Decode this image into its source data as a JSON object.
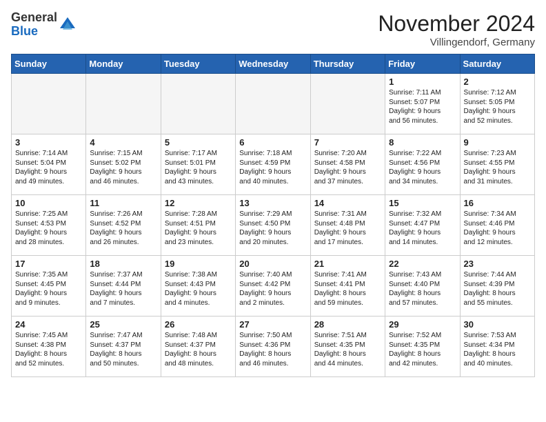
{
  "logo": {
    "general": "General",
    "blue": "Blue"
  },
  "title": "November 2024",
  "location": "Villingendorf, Germany",
  "days_of_week": [
    "Sunday",
    "Monday",
    "Tuesday",
    "Wednesday",
    "Thursday",
    "Friday",
    "Saturday"
  ],
  "weeks": [
    [
      {
        "day": "",
        "info": ""
      },
      {
        "day": "",
        "info": ""
      },
      {
        "day": "",
        "info": ""
      },
      {
        "day": "",
        "info": ""
      },
      {
        "day": "",
        "info": ""
      },
      {
        "day": "1",
        "info": "Sunrise: 7:11 AM\nSunset: 5:07 PM\nDaylight: 9 hours\nand 56 minutes."
      },
      {
        "day": "2",
        "info": "Sunrise: 7:12 AM\nSunset: 5:05 PM\nDaylight: 9 hours\nand 52 minutes."
      }
    ],
    [
      {
        "day": "3",
        "info": "Sunrise: 7:14 AM\nSunset: 5:04 PM\nDaylight: 9 hours\nand 49 minutes."
      },
      {
        "day": "4",
        "info": "Sunrise: 7:15 AM\nSunset: 5:02 PM\nDaylight: 9 hours\nand 46 minutes."
      },
      {
        "day": "5",
        "info": "Sunrise: 7:17 AM\nSunset: 5:01 PM\nDaylight: 9 hours\nand 43 minutes."
      },
      {
        "day": "6",
        "info": "Sunrise: 7:18 AM\nSunset: 4:59 PM\nDaylight: 9 hours\nand 40 minutes."
      },
      {
        "day": "7",
        "info": "Sunrise: 7:20 AM\nSunset: 4:58 PM\nDaylight: 9 hours\nand 37 minutes."
      },
      {
        "day": "8",
        "info": "Sunrise: 7:22 AM\nSunset: 4:56 PM\nDaylight: 9 hours\nand 34 minutes."
      },
      {
        "day": "9",
        "info": "Sunrise: 7:23 AM\nSunset: 4:55 PM\nDaylight: 9 hours\nand 31 minutes."
      }
    ],
    [
      {
        "day": "10",
        "info": "Sunrise: 7:25 AM\nSunset: 4:53 PM\nDaylight: 9 hours\nand 28 minutes."
      },
      {
        "day": "11",
        "info": "Sunrise: 7:26 AM\nSunset: 4:52 PM\nDaylight: 9 hours\nand 26 minutes."
      },
      {
        "day": "12",
        "info": "Sunrise: 7:28 AM\nSunset: 4:51 PM\nDaylight: 9 hours\nand 23 minutes."
      },
      {
        "day": "13",
        "info": "Sunrise: 7:29 AM\nSunset: 4:50 PM\nDaylight: 9 hours\nand 20 minutes."
      },
      {
        "day": "14",
        "info": "Sunrise: 7:31 AM\nSunset: 4:48 PM\nDaylight: 9 hours\nand 17 minutes."
      },
      {
        "day": "15",
        "info": "Sunrise: 7:32 AM\nSunset: 4:47 PM\nDaylight: 9 hours\nand 14 minutes."
      },
      {
        "day": "16",
        "info": "Sunrise: 7:34 AM\nSunset: 4:46 PM\nDaylight: 9 hours\nand 12 minutes."
      }
    ],
    [
      {
        "day": "17",
        "info": "Sunrise: 7:35 AM\nSunset: 4:45 PM\nDaylight: 9 hours\nand 9 minutes."
      },
      {
        "day": "18",
        "info": "Sunrise: 7:37 AM\nSunset: 4:44 PM\nDaylight: 9 hours\nand 7 minutes."
      },
      {
        "day": "19",
        "info": "Sunrise: 7:38 AM\nSunset: 4:43 PM\nDaylight: 9 hours\nand 4 minutes."
      },
      {
        "day": "20",
        "info": "Sunrise: 7:40 AM\nSunset: 4:42 PM\nDaylight: 9 hours\nand 2 minutes."
      },
      {
        "day": "21",
        "info": "Sunrise: 7:41 AM\nSunset: 4:41 PM\nDaylight: 8 hours\nand 59 minutes."
      },
      {
        "day": "22",
        "info": "Sunrise: 7:43 AM\nSunset: 4:40 PM\nDaylight: 8 hours\nand 57 minutes."
      },
      {
        "day": "23",
        "info": "Sunrise: 7:44 AM\nSunset: 4:39 PM\nDaylight: 8 hours\nand 55 minutes."
      }
    ],
    [
      {
        "day": "24",
        "info": "Sunrise: 7:45 AM\nSunset: 4:38 PM\nDaylight: 8 hours\nand 52 minutes."
      },
      {
        "day": "25",
        "info": "Sunrise: 7:47 AM\nSunset: 4:37 PM\nDaylight: 8 hours\nand 50 minutes."
      },
      {
        "day": "26",
        "info": "Sunrise: 7:48 AM\nSunset: 4:37 PM\nDaylight: 8 hours\nand 48 minutes."
      },
      {
        "day": "27",
        "info": "Sunrise: 7:50 AM\nSunset: 4:36 PM\nDaylight: 8 hours\nand 46 minutes."
      },
      {
        "day": "28",
        "info": "Sunrise: 7:51 AM\nSunset: 4:35 PM\nDaylight: 8 hours\nand 44 minutes."
      },
      {
        "day": "29",
        "info": "Sunrise: 7:52 AM\nSunset: 4:35 PM\nDaylight: 8 hours\nand 42 minutes."
      },
      {
        "day": "30",
        "info": "Sunrise: 7:53 AM\nSunset: 4:34 PM\nDaylight: 8 hours\nand 40 minutes."
      }
    ]
  ]
}
